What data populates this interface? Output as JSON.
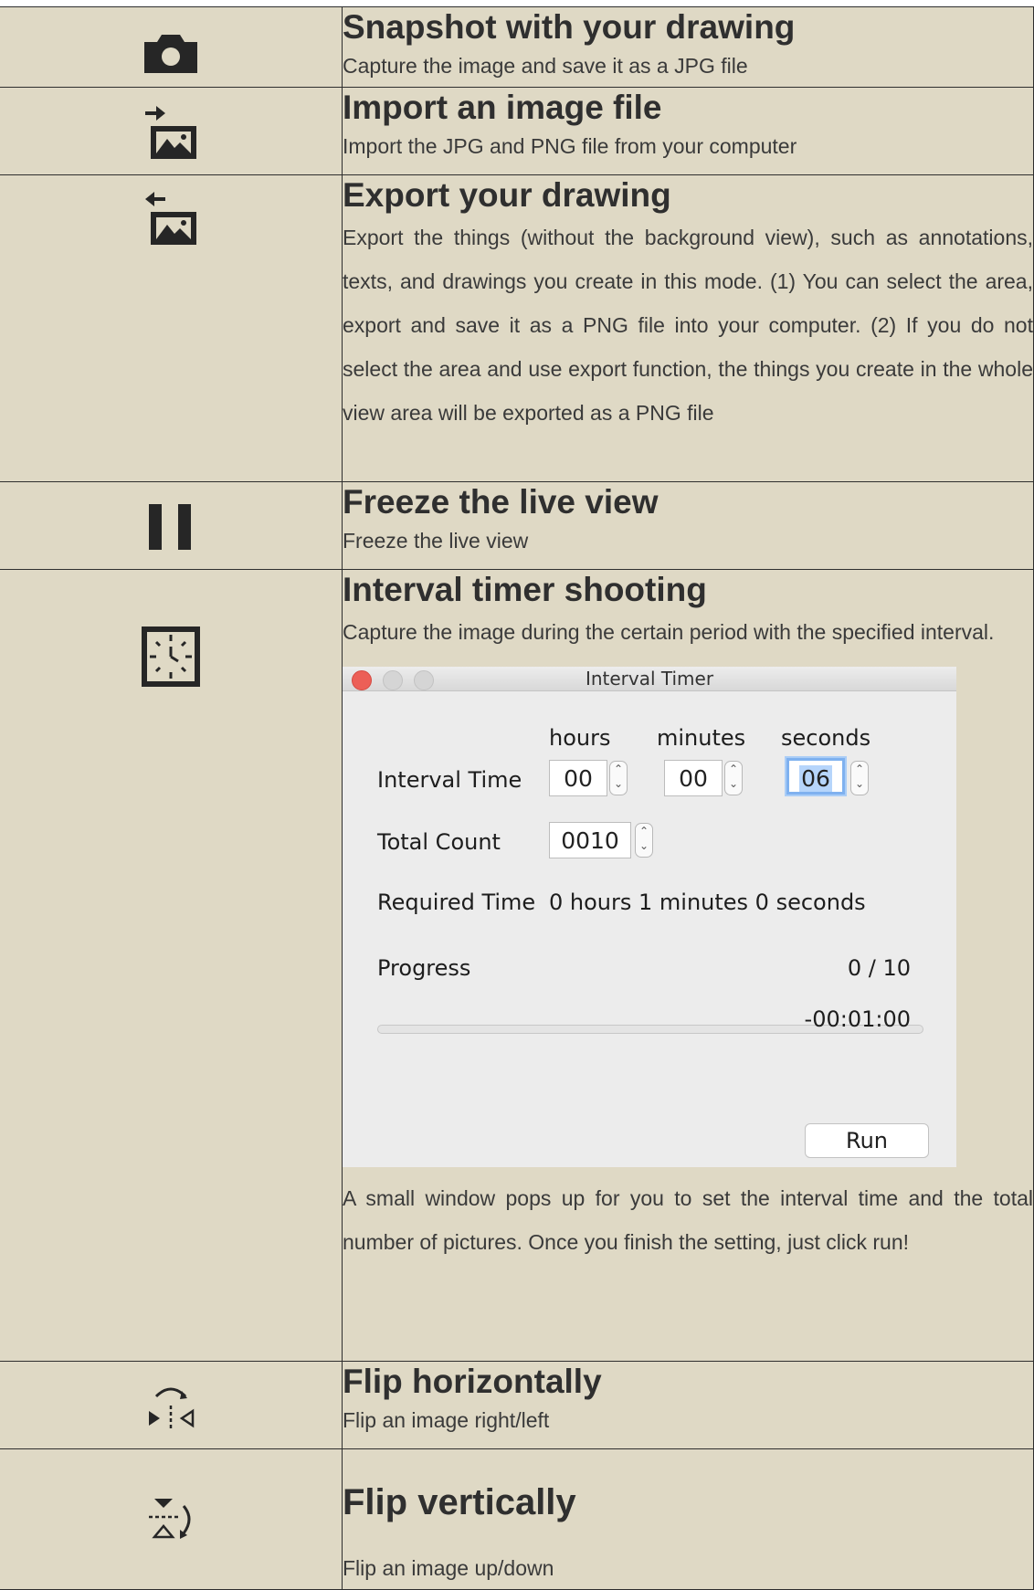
{
  "rows": [
    {
      "icon": "camera-icon",
      "title": "Snapshot with your drawing",
      "desc": "Capture the image and save it as a JPG file"
    },
    {
      "icon": "import-image-icon",
      "title": "Import an image file",
      "desc": "Import the JPG and PNG file from your computer"
    },
    {
      "icon": "export-image-icon",
      "title": "Export your drawing",
      "desc": "Export the things (without the background view), such as annotations, texts, and drawings you create in this mode. (1) You can select the area, export and save it as a PNG file into your computer. (2) If you do not select the area and use export function, the things you create in the whole view area will be exported as a PNG file"
    },
    {
      "icon": "pause-icon",
      "title": "Freeze the live view",
      "desc": "Freeze the live view"
    },
    {
      "icon": "interval-timer-icon",
      "title": "Interval timer shooting",
      "desc": "Capture the image during the certain period with the specified interval.",
      "desc_after": "A small window pops up for you to set the interval time and the total number of pictures. Once you finish the setting, just click run!"
    },
    {
      "icon": "flip-horizontal-icon",
      "title": "Flip horizontally",
      "desc": "Flip an image right/left"
    },
    {
      "icon": "flip-vertical-icon",
      "title": "Flip vertically",
      "desc": "Flip an image up/down"
    }
  ],
  "dialog": {
    "title": "Interval Timer",
    "col_hours": "hours",
    "col_minutes": "minutes",
    "col_seconds": "seconds",
    "interval_label": "Interval Time",
    "hours": "00",
    "minutes": "00",
    "seconds": "06",
    "count_label": "Total Count",
    "count": "0010",
    "required_label": "Required Time",
    "required_value": "0 hours 1 minutes 0 seconds",
    "progress_label": "Progress",
    "progress_value": "0 / 10",
    "progress_fraction": 0,
    "remaining": "-00:01:00",
    "run_label": "Run",
    "colors": {
      "close": "#ec5f57",
      "inactive": "#d5d5d5",
      "field_focus": "#7fb1ef"
    }
  }
}
